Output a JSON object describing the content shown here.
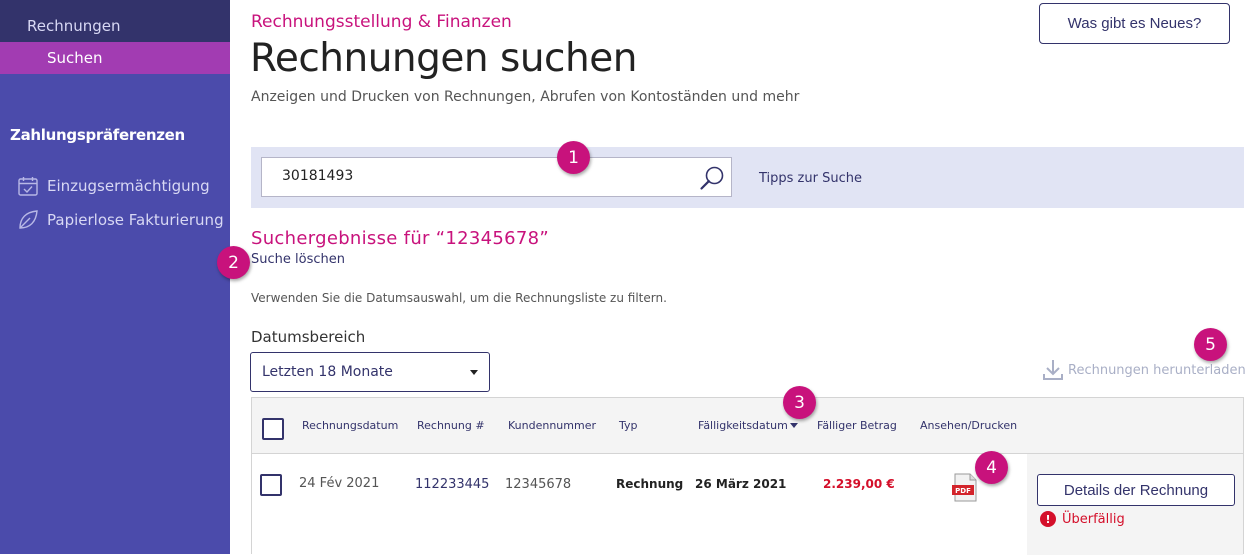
{
  "sidebar": {
    "top_link": "Rechnungen",
    "active_item": "Suchen",
    "section_title": "Zahlungspräferenzen",
    "items": [
      {
        "label": "Einzugsermächtigung",
        "icon": "calendar-check-icon"
      },
      {
        "label": "Papierlose Fakturierung",
        "icon": "leaf-icon"
      }
    ]
  },
  "header": {
    "brand": "Rechnungsstellung & Finanzen",
    "title": "Rechnungen suchen",
    "subtitle": "Anzeigen und Drucken von Rechnungen, Abrufen von Kontoständen und mehr",
    "news_button": "Was gibt es Neues?"
  },
  "search": {
    "value": "30181493",
    "icon": "search-icon",
    "tips_link": "Tipps zur Suche"
  },
  "results": {
    "title": "Suchergebnisse für “12345678”",
    "clear_link": "Suche löschen",
    "hint": "Verwenden Sie die Datumsauswahl, um die Rechnungsliste zu filtern.",
    "date_label": "Datumsbereich",
    "date_value": "Letzten 18 Monate",
    "download_label": "Rechnungen herunterladen"
  },
  "table": {
    "columns": [
      "Rechnungsdatum",
      "Rechnung #",
      "Kundennummer",
      "Typ",
      "Fälligkeitsdatum",
      "Fälliger Betrag",
      "Ansehen/Drucken"
    ],
    "rows": [
      {
        "date": "24 Fév 2021",
        "invoice": "112233445",
        "customer": "12345678",
        "type": "Rechnung",
        "due_date": "26 März 2021",
        "amount": "2.239,00 €",
        "pdf_label": "PDF",
        "details_button": "Details der Rechnung",
        "status": "Überfällig",
        "status_icon": "!"
      }
    ]
  },
  "callouts": [
    "1",
    "2",
    "3",
    "4",
    "5"
  ],
  "colors": {
    "sidebar": "#4b4bab",
    "sidebar_top": "#33336b",
    "active": "#a23cb2",
    "brand": "#c8127c",
    "navy": "#33336b",
    "overdue": "#d40f2a"
  }
}
